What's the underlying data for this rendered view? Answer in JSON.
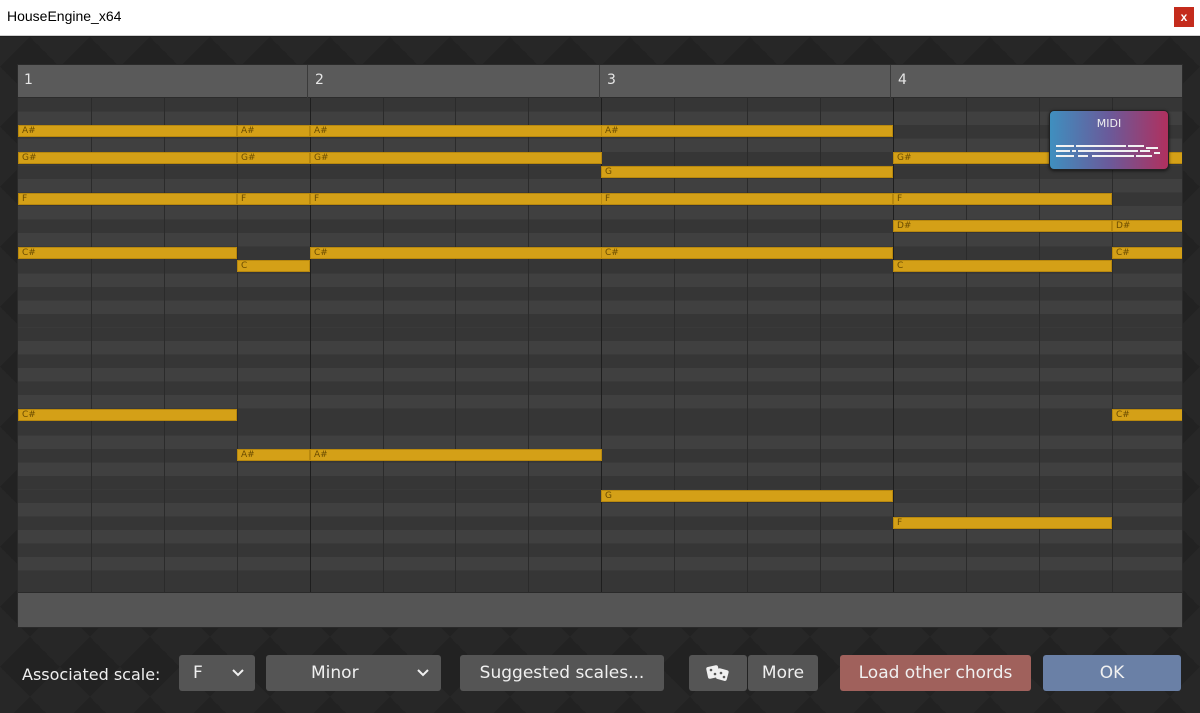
{
  "window": {
    "title": "HouseEngine_x64",
    "close_glyph": "x"
  },
  "ruler": {
    "bars": [
      "1",
      "2",
      "3",
      "4"
    ]
  },
  "notes": [
    {
      "label": "A#",
      "row": 2,
      "start": 0,
      "len": 3
    },
    {
      "label": "A#",
      "row": 2,
      "start": 3,
      "len": 1
    },
    {
      "label": "A#",
      "row": 2,
      "start": 4,
      "len": 4
    },
    {
      "label": "A#",
      "row": 2,
      "start": 8,
      "len": 4
    },
    {
      "label": "G#",
      "row": 4,
      "start": 0,
      "len": 3
    },
    {
      "label": "G#",
      "row": 4,
      "start": 3,
      "len": 1
    },
    {
      "label": "G#",
      "row": 4,
      "start": 4,
      "len": 4
    },
    {
      "label": "G#",
      "row": 4,
      "start": 12,
      "len": 4
    },
    {
      "label": "G",
      "row": 5,
      "start": 8,
      "len": 4
    },
    {
      "label": "F",
      "row": 7,
      "start": 0,
      "len": 3
    },
    {
      "label": "F",
      "row": 7,
      "start": 3,
      "len": 1
    },
    {
      "label": "F",
      "row": 7,
      "start": 4,
      "len": 4
    },
    {
      "label": "F",
      "row": 7,
      "start": 8,
      "len": 4
    },
    {
      "label": "F",
      "row": 7,
      "start": 12,
      "len": 3
    },
    {
      "label": "D#",
      "row": 9,
      "start": 12,
      "len": 3
    },
    {
      "label": "D#",
      "row": 9,
      "start": 15,
      "len": 1
    },
    {
      "label": "C#",
      "row": 11,
      "start": 0,
      "len": 3
    },
    {
      "label": "C#",
      "row": 11,
      "start": 4,
      "len": 4
    },
    {
      "label": "C#",
      "row": 11,
      "start": 8,
      "len": 4
    },
    {
      "label": "C#",
      "row": 11,
      "start": 15,
      "len": 1
    },
    {
      "label": "C",
      "row": 12,
      "start": 3,
      "len": 1
    },
    {
      "label": "C",
      "row": 12,
      "start": 12,
      "len": 3
    },
    {
      "label": "C#",
      "row": 23,
      "start": 0,
      "len": 3
    },
    {
      "label": "C#",
      "row": 23,
      "start": 15,
      "len": 1
    },
    {
      "label": "A#",
      "row": 26,
      "start": 3,
      "len": 1
    },
    {
      "label": "A#",
      "row": 26,
      "start": 4,
      "len": 4
    },
    {
      "label": "G",
      "row": 29,
      "start": 8,
      "len": 4
    },
    {
      "label": "F",
      "row": 31,
      "start": 12,
      "len": 3
    }
  ],
  "midi_widget": {
    "label": "MIDI"
  },
  "controls": {
    "scale_label": "Associated scale:",
    "key_value": "F",
    "mode_value": "Minor",
    "suggested_label": "Suggested scales...",
    "dice_icon": "dice-icon",
    "more_label": "More",
    "load_label": "Load other chords",
    "ok_label": "OK"
  },
  "colors": {
    "note": "#d4a017",
    "load_button": "#a0615c",
    "ok_button": "#6a80a6"
  }
}
